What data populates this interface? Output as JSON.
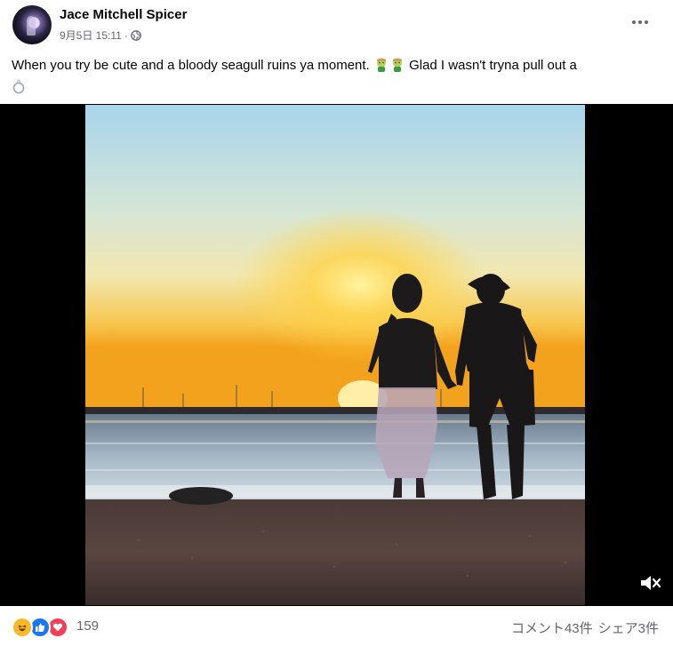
{
  "post": {
    "author": "Jace Mitchell Spicer",
    "date": "9月5日 15:11",
    "separator": "·",
    "privacy_icon": "globe-icon",
    "more_label": "•••",
    "text_part1": "When you try be cute and a bloody seagull ruins ya moment.",
    "text_part2": "Glad I wasn't tryna pull out a",
    "emojis": [
      "nauseated-face",
      "nauseated-face",
      "ring"
    ]
  },
  "video": {
    "mute_icon": "speaker-muted-icon"
  },
  "footer": {
    "reactions": [
      "haha",
      "like",
      "love"
    ],
    "reaction_count": "159",
    "comments": "コメント43件",
    "shares": "シェア3件"
  },
  "colors": {
    "text": "#050505",
    "secondary": "#65676b",
    "like_blue": "#1877f2",
    "love_red": "#f33e58",
    "haha_yellow": "#f7b928"
  }
}
